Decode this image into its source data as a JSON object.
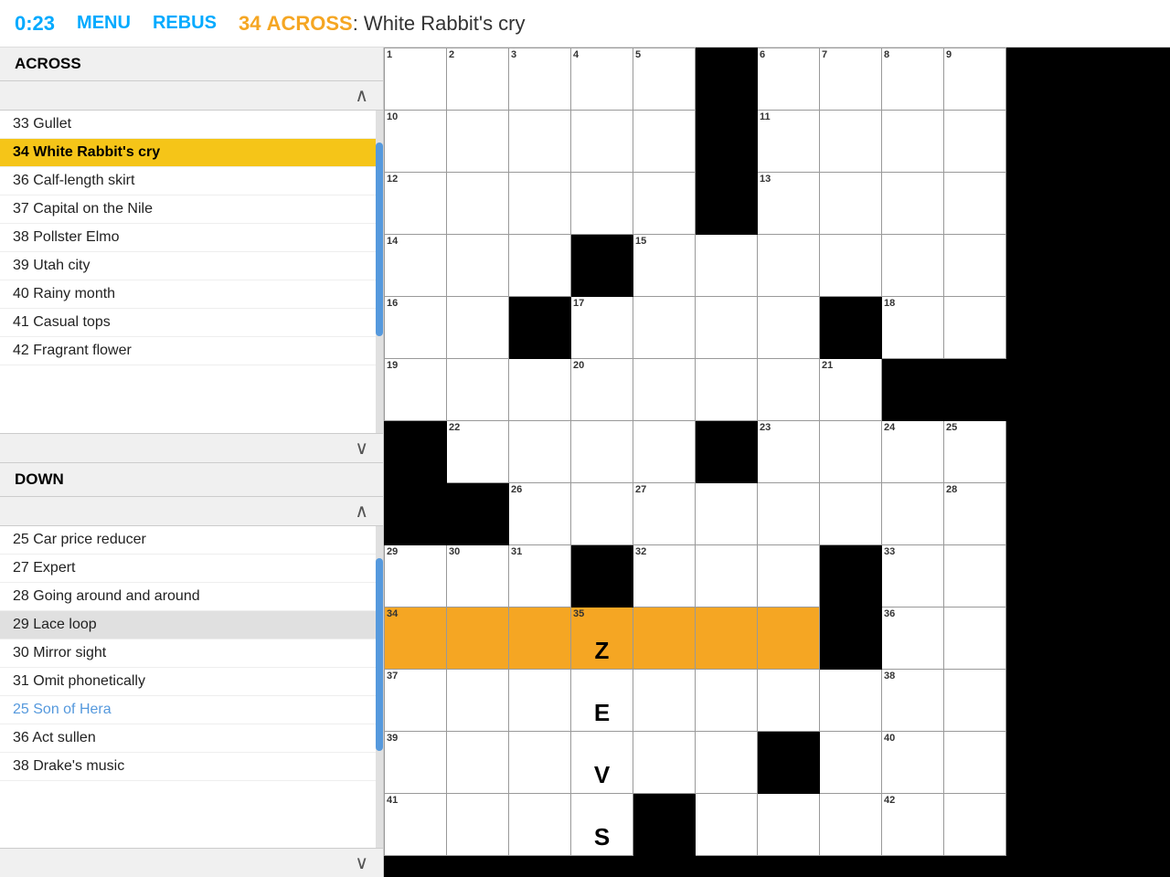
{
  "header": {
    "timer": "0:23",
    "menu_label": "MENU",
    "rebus_label": "REBUS",
    "active_clue_num": "34",
    "active_clue_dir": "ACROSS",
    "active_clue_colon": ":",
    "active_clue_text": " White Rabbit's cry"
  },
  "sidebar": {
    "across_label": "ACROSS",
    "down_label": "DOWN",
    "across_clues": [
      {
        "num": "33",
        "text": "Gullet",
        "state": "normal"
      },
      {
        "num": "34",
        "text": "White Rabbit's cry",
        "state": "active-yellow"
      },
      {
        "num": "36",
        "text": "Calf-length skirt",
        "state": "normal"
      },
      {
        "num": "37",
        "text": "Capital on the Nile",
        "state": "normal"
      },
      {
        "num": "38",
        "text": "Pollster Elmo",
        "state": "normal"
      },
      {
        "num": "39",
        "text": "Utah city",
        "state": "normal"
      },
      {
        "num": "40",
        "text": "Rainy month",
        "state": "normal"
      },
      {
        "num": "41",
        "text": "Casual tops",
        "state": "normal"
      },
      {
        "num": "42",
        "text": "Fragrant flower",
        "state": "normal"
      }
    ],
    "down_clues": [
      {
        "num": "25",
        "text": "Car price reducer",
        "state": "normal"
      },
      {
        "num": "27",
        "text": "Expert",
        "state": "normal"
      },
      {
        "num": "28",
        "text": "Going around and around",
        "state": "normal"
      },
      {
        "num": "29",
        "text": "Lace loop",
        "state": "active-gray"
      },
      {
        "num": "30",
        "text": "Mirror sight",
        "state": "normal"
      },
      {
        "num": "31",
        "text": "Omit phonetically",
        "state": "normal"
      },
      {
        "num": "25",
        "text": "Son of Hera",
        "state": "blue-text"
      },
      {
        "num": "36",
        "text": "Act sullen",
        "state": "normal"
      },
      {
        "num": "38",
        "text": "Drake's music",
        "state": "normal"
      }
    ]
  },
  "grid": {
    "cells": [
      [
        {
          "num": "1",
          "state": "white"
        },
        {
          "num": "2",
          "state": "white"
        },
        {
          "num": "3",
          "state": "white"
        },
        {
          "num": "4",
          "state": "white"
        },
        {
          "num": "5",
          "state": "white"
        },
        {
          "num": "",
          "state": "black"
        },
        {
          "num": "6",
          "state": "white"
        },
        {
          "num": "7",
          "state": "white"
        },
        {
          "num": "8",
          "state": "white"
        },
        {
          "num": "9",
          "state": "white"
        }
      ],
      [
        {
          "num": "10",
          "state": "white"
        },
        {
          "num": "",
          "state": "white"
        },
        {
          "num": "",
          "state": "white"
        },
        {
          "num": "",
          "state": "white"
        },
        {
          "num": "",
          "state": "white"
        },
        {
          "num": "",
          "state": "black"
        },
        {
          "num": "11",
          "state": "white"
        },
        {
          "num": "",
          "state": "white"
        },
        {
          "num": "",
          "state": "white"
        },
        {
          "num": "",
          "state": "white"
        }
      ],
      [
        {
          "num": "12",
          "state": "white"
        },
        {
          "num": "",
          "state": "white"
        },
        {
          "num": "",
          "state": "white"
        },
        {
          "num": "",
          "state": "white"
        },
        {
          "num": "",
          "state": "white"
        },
        {
          "num": "",
          "state": "black"
        },
        {
          "num": "13",
          "state": "white"
        },
        {
          "num": "",
          "state": "white"
        },
        {
          "num": "",
          "state": "white"
        },
        {
          "num": "",
          "state": "white"
        }
      ],
      [
        {
          "num": "14",
          "state": "white"
        },
        {
          "num": "",
          "state": "white"
        },
        {
          "num": "",
          "state": "white"
        },
        {
          "num": "",
          "state": "black"
        },
        {
          "num": "15",
          "state": "white"
        },
        {
          "num": "",
          "state": "white"
        },
        {
          "num": "",
          "state": "white"
        },
        {
          "num": "",
          "state": "white"
        },
        {
          "num": "",
          "state": "white"
        },
        {
          "num": "",
          "state": "white"
        }
      ],
      [
        {
          "num": "16",
          "state": "white"
        },
        {
          "num": "",
          "state": "white"
        },
        {
          "num": "",
          "state": "black"
        },
        {
          "num": "17",
          "state": "white"
        },
        {
          "num": "",
          "state": "white"
        },
        {
          "num": "",
          "state": "white"
        },
        {
          "num": "",
          "state": "white"
        },
        {
          "num": "",
          "state": "black"
        },
        {
          "num": "18",
          "state": "white"
        },
        {
          "num": "",
          "state": "white"
        }
      ],
      [
        {
          "num": "19",
          "state": "white"
        },
        {
          "num": "",
          "state": "white"
        },
        {
          "num": "",
          "state": "white"
        },
        {
          "num": "20",
          "state": "white"
        },
        {
          "num": "",
          "state": "white"
        },
        {
          "num": "",
          "state": "white"
        },
        {
          "num": "",
          "state": "white"
        },
        {
          "num": "21",
          "state": "white"
        },
        {
          "num": "",
          "state": "black"
        },
        {
          "num": "",
          "state": "black"
        }
      ],
      [
        {
          "num": "",
          "state": "black"
        },
        {
          "num": "22",
          "state": "white"
        },
        {
          "num": "",
          "state": "white"
        },
        {
          "num": "",
          "state": "white"
        },
        {
          "num": "",
          "state": "white"
        },
        {
          "num": "",
          "state": "black"
        },
        {
          "num": "23",
          "state": "white"
        },
        {
          "num": "",
          "state": "white"
        },
        {
          "num": "24",
          "state": "white"
        },
        {
          "num": "25",
          "state": "white"
        }
      ],
      [
        {
          "num": "",
          "state": "black"
        },
        {
          "num": "",
          "state": "black"
        },
        {
          "num": "26",
          "state": "white"
        },
        {
          "num": "",
          "state": "white"
        },
        {
          "num": "27",
          "state": "white"
        },
        {
          "num": "",
          "state": "white"
        },
        {
          "num": "",
          "state": "white"
        },
        {
          "num": "",
          "state": "white"
        },
        {
          "num": "",
          "state": "white"
        },
        {
          "num": "28",
          "state": "white"
        }
      ],
      [
        {
          "num": "29",
          "state": "white"
        },
        {
          "num": "30",
          "state": "white"
        },
        {
          "num": "31",
          "state": "white"
        },
        {
          "num": "",
          "state": "black"
        },
        {
          "num": "32",
          "state": "white"
        },
        {
          "num": "",
          "state": "white"
        },
        {
          "num": "",
          "state": "white"
        },
        {
          "num": "",
          "state": "black"
        },
        {
          "num": "33",
          "state": "white"
        },
        {
          "num": "",
          "state": "white"
        }
      ],
      [
        {
          "num": "34",
          "state": "orange",
          "letter": ""
        },
        {
          "num": "",
          "state": "orange",
          "letter": ""
        },
        {
          "num": "",
          "state": "orange",
          "letter": ""
        },
        {
          "num": "35",
          "state": "orange",
          "letter": "Z"
        },
        {
          "num": "",
          "state": "orange",
          "letter": ""
        },
        {
          "num": "",
          "state": "orange",
          "letter": ""
        },
        {
          "num": "",
          "state": "orange",
          "letter": ""
        },
        {
          "num": "",
          "state": "black"
        },
        {
          "num": "36",
          "state": "white"
        },
        {
          "num": "",
          "state": "white"
        }
      ],
      [
        {
          "num": "37",
          "state": "white"
        },
        {
          "num": "",
          "state": "white"
        },
        {
          "num": "",
          "state": "white"
        },
        {
          "num": "",
          "state": "white",
          "letter": "E"
        },
        {
          "num": "",
          "state": "white"
        },
        {
          "num": "",
          "state": "white"
        },
        {
          "num": "",
          "state": "white"
        },
        {
          "num": "",
          "state": "white"
        },
        {
          "num": "38",
          "state": "white"
        },
        {
          "num": "",
          "state": "white"
        }
      ],
      [
        {
          "num": "39",
          "state": "white"
        },
        {
          "num": "",
          "state": "white"
        },
        {
          "num": "",
          "state": "white"
        },
        {
          "num": "",
          "state": "white",
          "letter": "V"
        },
        {
          "num": "",
          "state": "white"
        },
        {
          "num": "",
          "state": "white"
        },
        {
          "num": "",
          "state": "black"
        },
        {
          "num": "",
          "state": "white"
        },
        {
          "num": "40",
          "state": "white"
        },
        {
          "num": "",
          "state": "white"
        }
      ],
      [
        {
          "num": "41",
          "state": "white"
        },
        {
          "num": "",
          "state": "white"
        },
        {
          "num": "",
          "state": "white"
        },
        {
          "num": "",
          "state": "white",
          "letter": "S"
        },
        {
          "num": "",
          "state": "black"
        },
        {
          "num": "",
          "state": "white"
        },
        {
          "num": "",
          "state": "white"
        },
        {
          "num": "",
          "state": "white"
        },
        {
          "num": "42",
          "state": "white"
        },
        {
          "num": "",
          "state": "white"
        }
      ]
    ]
  }
}
